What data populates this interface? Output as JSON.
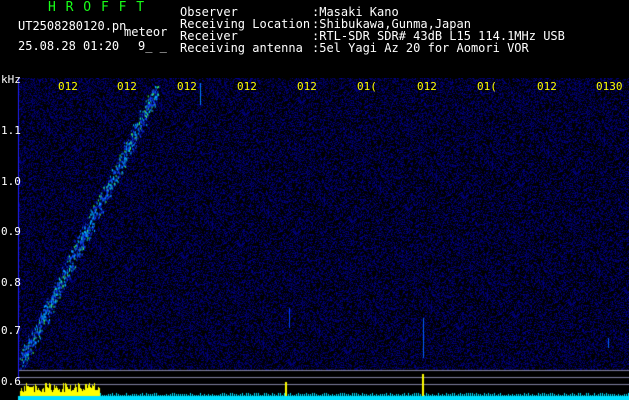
{
  "header": {
    "program": "H R O F F T",
    "file_name": "UT2508280120.pn",
    "mode": "meteor",
    "datetime": "25.08.28 01:20",
    "marker": "9_ _",
    "info": [
      {
        "label": "Observer",
        "value": ":Masaki Kano"
      },
      {
        "label": "Receiving Location",
        "value": ":Shibukawa,Gunma,Japan"
      },
      {
        "label": "Receiver",
        "value": ":RTL-SDR SDR# 43dB L15 114.1MHz USB"
      },
      {
        "label": "Receiving antenna",
        "value": ":5el Yagi Az 20 for Aomori VOR"
      }
    ]
  },
  "time_axis": {
    "labels": [
      "012",
      "012",
      "012",
      "012",
      "012",
      "01(",
      "012",
      "01(",
      "012",
      "0130"
    ]
  },
  "freq_axis": {
    "unit": "kHz",
    "labels": [
      "1.1",
      "1.0",
      "0.9",
      "0.8",
      "0.7",
      "0.6"
    ]
  },
  "colors": {
    "background": "#000000",
    "noise_floor": "#0a0a6e",
    "signal_hot": "#ffff00",
    "baseline": "#00e0ff"
  }
}
